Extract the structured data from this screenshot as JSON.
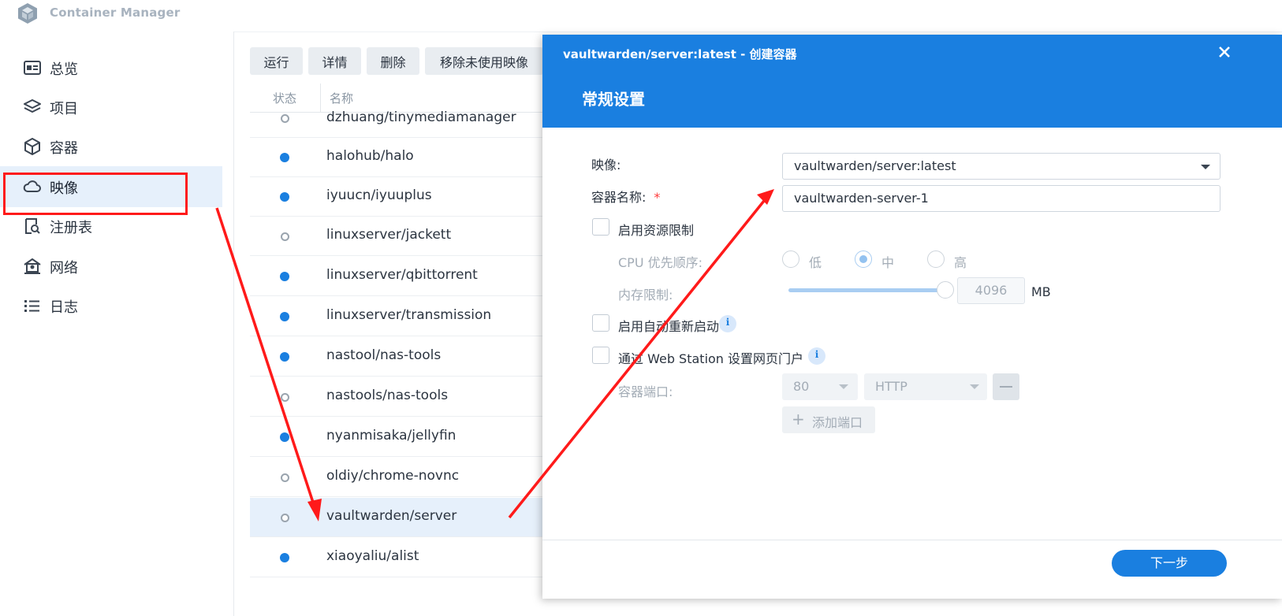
{
  "app": {
    "title": "Container Manager"
  },
  "sidebar": {
    "items": [
      {
        "label": "总览",
        "icon": "overview-icon"
      },
      {
        "label": "项目",
        "icon": "layers-icon"
      },
      {
        "label": "容器",
        "icon": "cube-icon"
      },
      {
        "label": "映像",
        "icon": "cloud-icon",
        "active": true
      },
      {
        "label": "注册表",
        "icon": "registry-search-icon"
      },
      {
        "label": "网络",
        "icon": "network-icon"
      },
      {
        "label": "日志",
        "icon": "list-icon"
      }
    ]
  },
  "toolbar": {
    "run": "运行",
    "details": "详情",
    "delete": "删除",
    "remove_unused": "移除未使用映像"
  },
  "table": {
    "headers": {
      "status": "状态",
      "name": "名称"
    },
    "rows": [
      {
        "name": "dzhuang/tinymediamanager",
        "status": "stopped"
      },
      {
        "name": "halohub/halo",
        "status": "running"
      },
      {
        "name": "iyuucn/iyuuplus",
        "status": "running"
      },
      {
        "name": "linuxserver/jackett",
        "status": "stopped"
      },
      {
        "name": "linuxserver/qbittorrent",
        "status": "running"
      },
      {
        "name": "linuxserver/transmission",
        "status": "running"
      },
      {
        "name": "nastool/nas-tools",
        "status": "running"
      },
      {
        "name": "nastools/nas-tools",
        "status": "stopped"
      },
      {
        "name": "nyanmisaka/jellyfin",
        "status": "running"
      },
      {
        "name": "oldiy/chrome-novnc",
        "status": "stopped"
      },
      {
        "name": "vaultwarden/server",
        "status": "stopped",
        "selected": true
      },
      {
        "name": "xiaoyaliu/alist",
        "status": "running"
      }
    ]
  },
  "modal": {
    "title": "vaultwarden/server:latest - 创建容器",
    "subtitle": "常规设置",
    "image_label": "映像:",
    "image_value": "vaultwarden/server:latest",
    "container_name_label": "容器名称:",
    "required_mark": "*",
    "container_name_value": "vaultwarden-server-1",
    "enable_resource_limit": "启用资源限制",
    "cpu_priority_label": "CPU 优先顺序:",
    "cpu_options": [
      "低",
      "中",
      "高"
    ],
    "cpu_selected": "中",
    "memory_limit_label": "内存限制:",
    "memory_value": "4096",
    "memory_unit": "MB",
    "enable_auto_restart": "启用自动重新启动",
    "web_station_portal": "通过 Web Station 设置网页门户",
    "container_port_label": "容器端口:",
    "port_value": "80",
    "protocol_value": "HTTP",
    "add_port": "添加端口",
    "next_button": "下一步"
  },
  "colors": {
    "accent": "#1a7fe0",
    "annotation": "#ff1a1a",
    "selected_row": "#e6f0fb"
  }
}
